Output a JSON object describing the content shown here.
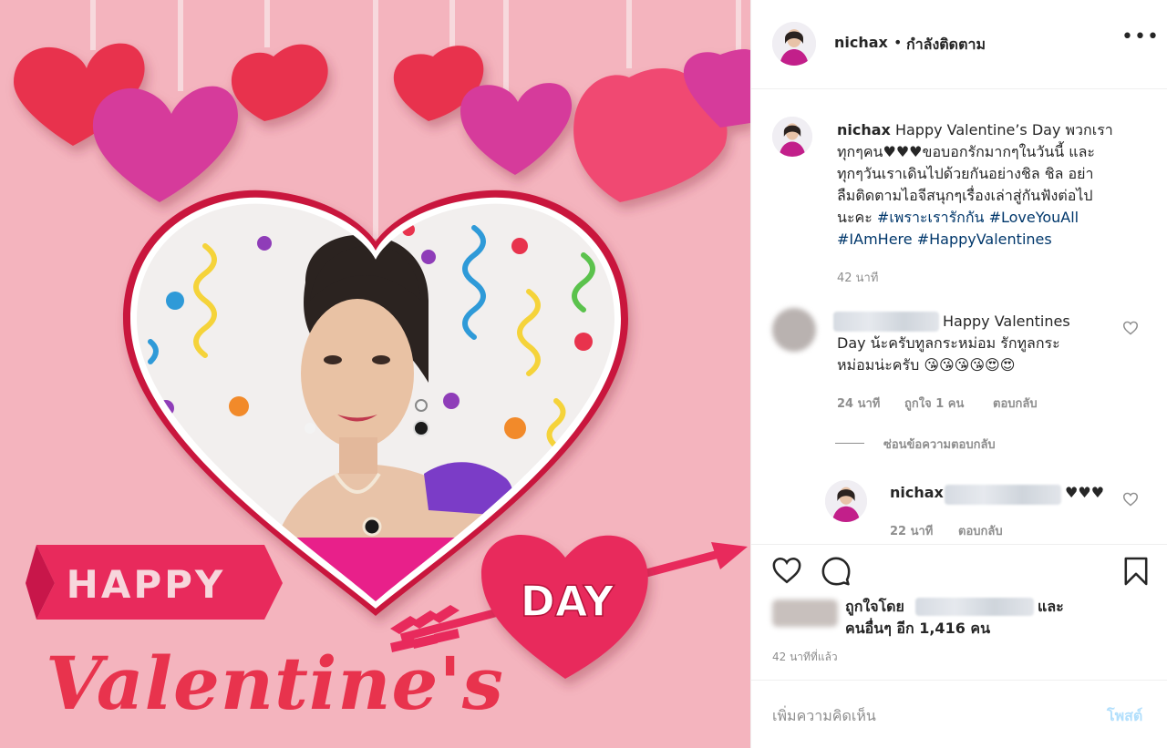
{
  "image": {
    "banner_happy": "HAPPY",
    "heart_day": "DAY",
    "script_valentines": "Valentine's",
    "colors": {
      "background": "#f4b4be",
      "red": "#e8334d",
      "magenta": "#d63a9b",
      "ribbon": "#e82a5c"
    }
  },
  "header": {
    "username": "nichax",
    "separator": "•",
    "follow_status": "กำลังติดตาม",
    "more_icon": "more-horizontal-icon",
    "more_label": "•••"
  },
  "caption": {
    "username": "nichax",
    "lines": [
      "Happy Valentine’s Day พวกเรา",
      "ทุกๆคน♥♥♥ขอบอกรักมากๆในวันนี้ และ",
      "ทุกๆวันเราเดินไปด้วยกันอย่างชิล ชิล อย่า",
      "ลืมติดตามไอจีสนุกๆเรื่องเล่าสู่กันฟังต่อไป",
      "นะคะ"
    ],
    "hashtags_line1": [
      "#เพราะเรารักกัน",
      "#LoveYouAll"
    ],
    "hashtags_line2": [
      "#IAmHere",
      "#HappyValentines"
    ],
    "time": "42 นาที"
  },
  "comment1": {
    "lines": [
      "Happy Valentines",
      "Day น้ะครับทูลกระหม่อม รักทูลกระ",
      "หม่อมน่ะครับ 😘😘😘😘😍😍"
    ],
    "time": "24 นาที",
    "likes": "ถูกใจ 1 คน",
    "reply": "ตอบกลับ",
    "hide_replies": "ซ่อนข้อความตอบกลับ"
  },
  "reply1": {
    "username": "nichax",
    "text": "♥♥♥",
    "time": "22 นาที",
    "reply": "ตอบกลับ"
  },
  "likes": {
    "liked_by": "ถูกใจโดย",
    "and": "และ",
    "others": "คนอื่นๆ อีก 1,416 คน",
    "timestamp": "42 นาทีที่แล้ว"
  },
  "comment_box": {
    "placeholder": "เพิ่มความคิดเห็น",
    "post_label": "โพสต์"
  }
}
